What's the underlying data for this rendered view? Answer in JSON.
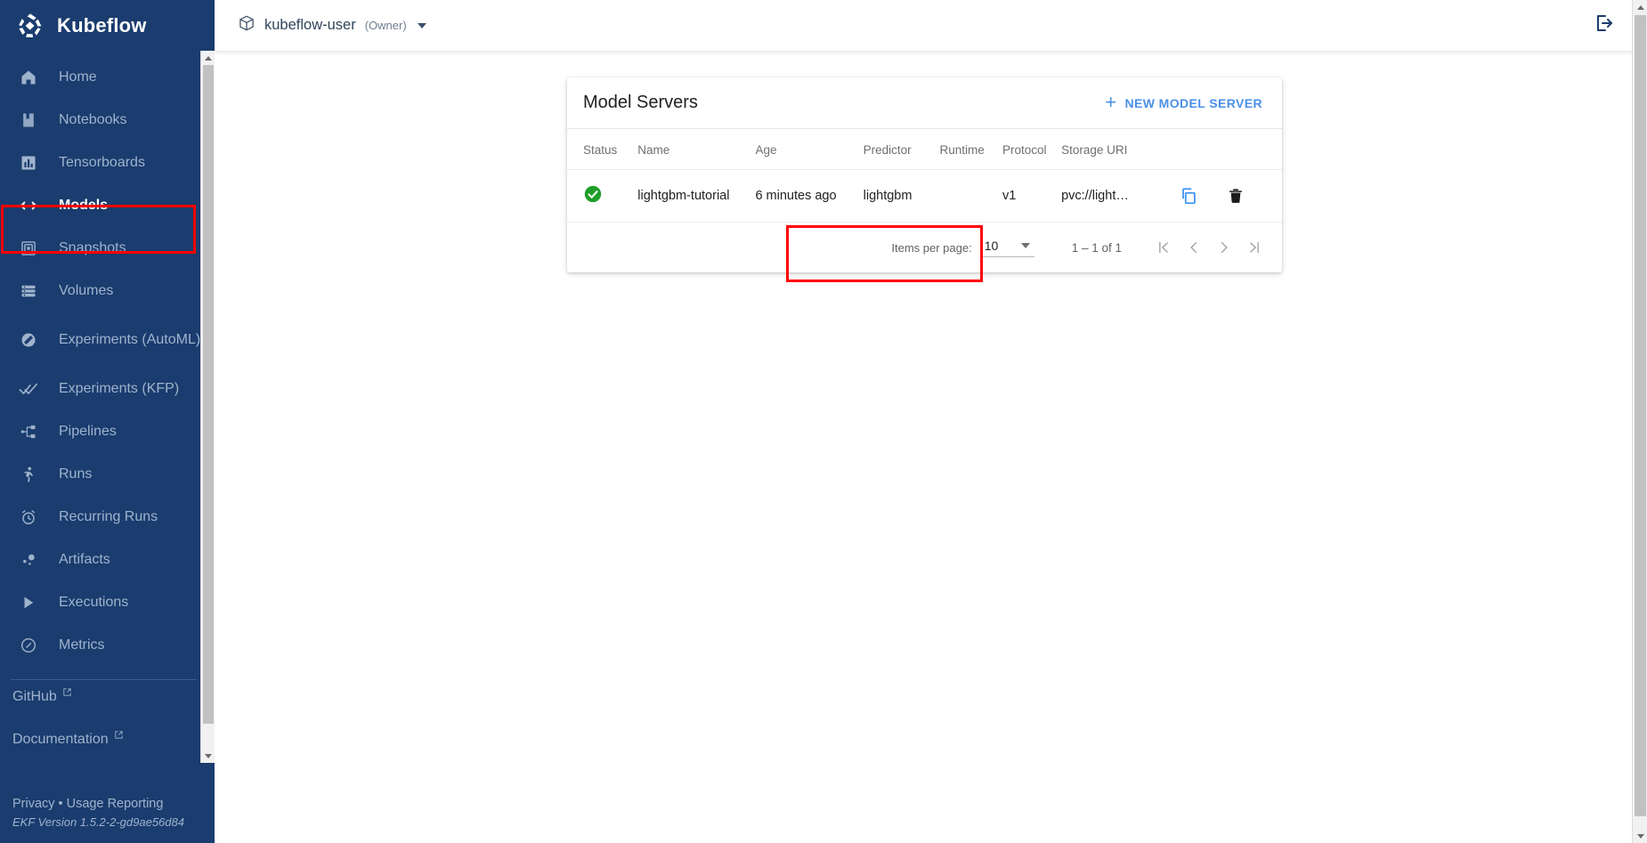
{
  "brand": {
    "name": "Kubeflow",
    "logo_icon": "kubeflow-logo"
  },
  "sidebar": {
    "items": [
      {
        "label": "Home",
        "icon": "home-icon",
        "active": false
      },
      {
        "label": "Notebooks",
        "icon": "notebook-icon",
        "active": false
      },
      {
        "label": "Tensorboards",
        "icon": "chart-bar-icon",
        "active": false
      },
      {
        "label": "Models",
        "icon": "code-brackets-icon",
        "active": true
      },
      {
        "label": "Snapshots",
        "icon": "snapshot-icon",
        "active": false
      },
      {
        "label": "Volumes",
        "icon": "storage-icon",
        "active": false
      },
      {
        "label": "Experiments (AutoML)",
        "icon": "katib-icon",
        "active": false
      },
      {
        "label": "Experiments (KFP)",
        "icon": "double-check-icon",
        "active": false
      },
      {
        "label": "Pipelines",
        "icon": "pipeline-icon",
        "active": false
      },
      {
        "label": "Runs",
        "icon": "runner-icon",
        "active": false
      },
      {
        "label": "Recurring Runs",
        "icon": "alarm-clock-icon",
        "active": false
      },
      {
        "label": "Artifacts",
        "icon": "artifact-icon",
        "active": false
      },
      {
        "label": "Executions",
        "icon": "play-triangle-icon",
        "active": false
      },
      {
        "label": "Metrics",
        "icon": "speedometer-icon",
        "active": false
      }
    ],
    "external_links": [
      {
        "label": "GitHub",
        "icon": "external-link-icon"
      },
      {
        "label": "Documentation",
        "icon": "external-link-icon"
      }
    ],
    "footer": {
      "privacy": "Privacy",
      "separator": "•",
      "usage_reporting": "Usage Reporting",
      "version": "EKF Version 1.5.2-2-gd9ae56d84"
    }
  },
  "topbar": {
    "namespace_icon": "package-icon",
    "namespace": "kubeflow-user",
    "role": "(Owner)",
    "dropdown_icon": "chevron-down-icon",
    "logout_icon": "logout-icon"
  },
  "card": {
    "title": "Model Servers",
    "new_button": {
      "label": "NEW MODEL SERVER",
      "icon": "plus-icon"
    },
    "columns": [
      "Status",
      "Name",
      "Age",
      "Predictor",
      "Runtime",
      "Protocol",
      "Storage URI",
      ""
    ],
    "rows": [
      {
        "status_icon": "check-circle-green-icon",
        "name": "lightgbm-tutorial",
        "age": "6 minutes ago",
        "predictor": "lightgbm",
        "runtime": "",
        "protocol": "v1",
        "storage_uri": "pvc://light…",
        "copy_icon": "copy-icon",
        "delete_icon": "trash-icon"
      }
    ],
    "paginator": {
      "items_per_page_label": "Items per page:",
      "items_per_page_value": "10",
      "range": "1 – 1 of 1",
      "first_page_icon": "first-page-icon",
      "prev_page_icon": "prev-page-icon",
      "next_page_icon": "next-page-icon",
      "last_page_icon": "last-page-icon"
    }
  },
  "colors": {
    "sidebar_bg": "#1a3c6e",
    "accent_blue": "#4a90e8",
    "status_green": "#1e9e28",
    "annotation_red": "#ff0000",
    "copy_icon_blue": "#3d92f5"
  }
}
